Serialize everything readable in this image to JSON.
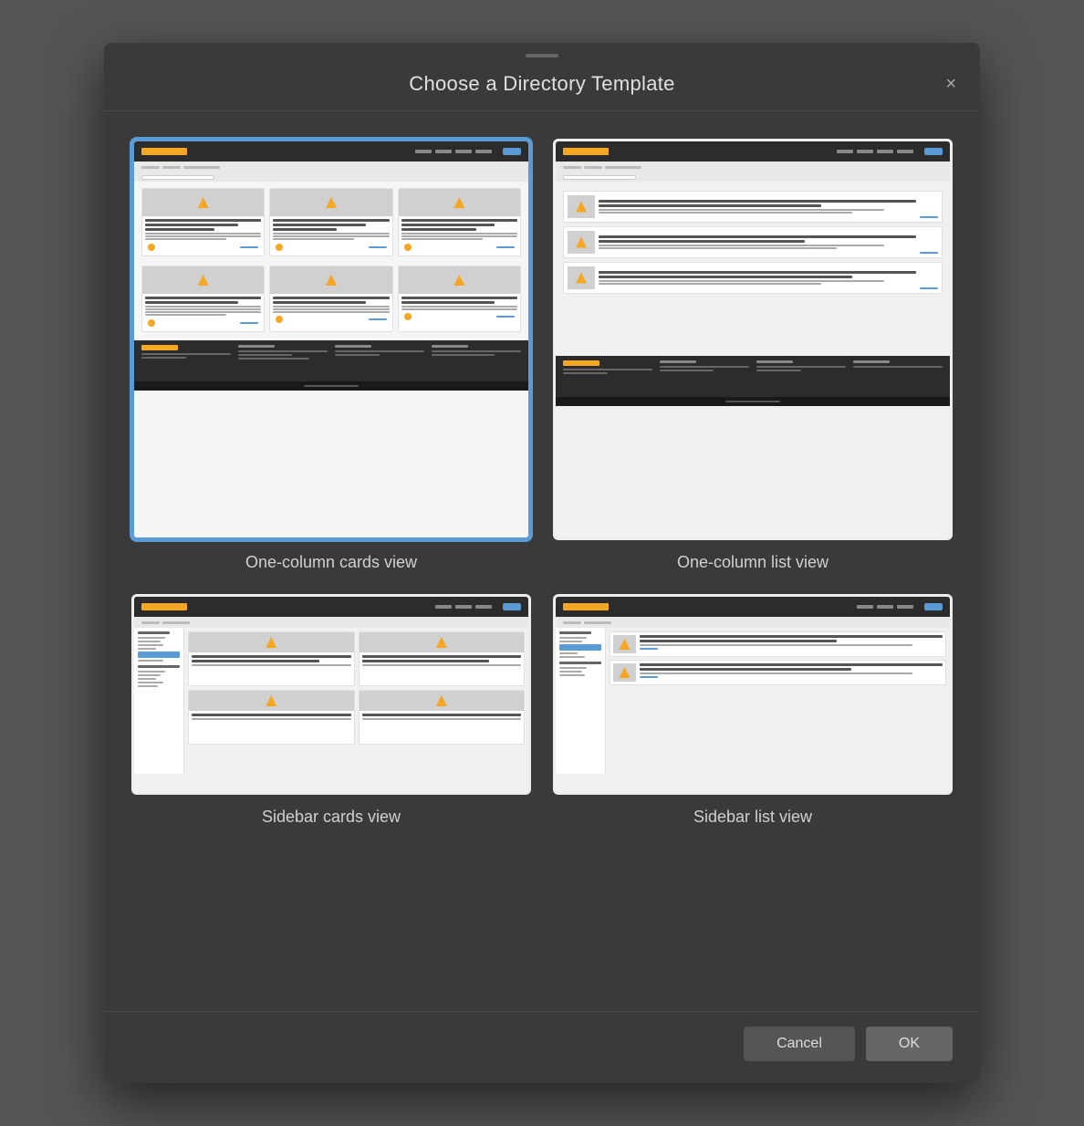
{
  "modal": {
    "drag_handle": "drag-handle",
    "title": "Choose a Directory Template",
    "close_label": "×"
  },
  "templates": [
    {
      "id": "one-column-cards",
      "label": "One-column cards view",
      "selected": true
    },
    {
      "id": "one-column-list",
      "label": "One-column list view",
      "selected": false
    },
    {
      "id": "sidebar-cards",
      "label": "Sidebar cards view",
      "selected": false
    },
    {
      "id": "sidebar-list",
      "label": "Sidebar list view",
      "selected": false
    }
  ],
  "footer": {
    "cancel_label": "Cancel",
    "ok_label": "OK"
  }
}
